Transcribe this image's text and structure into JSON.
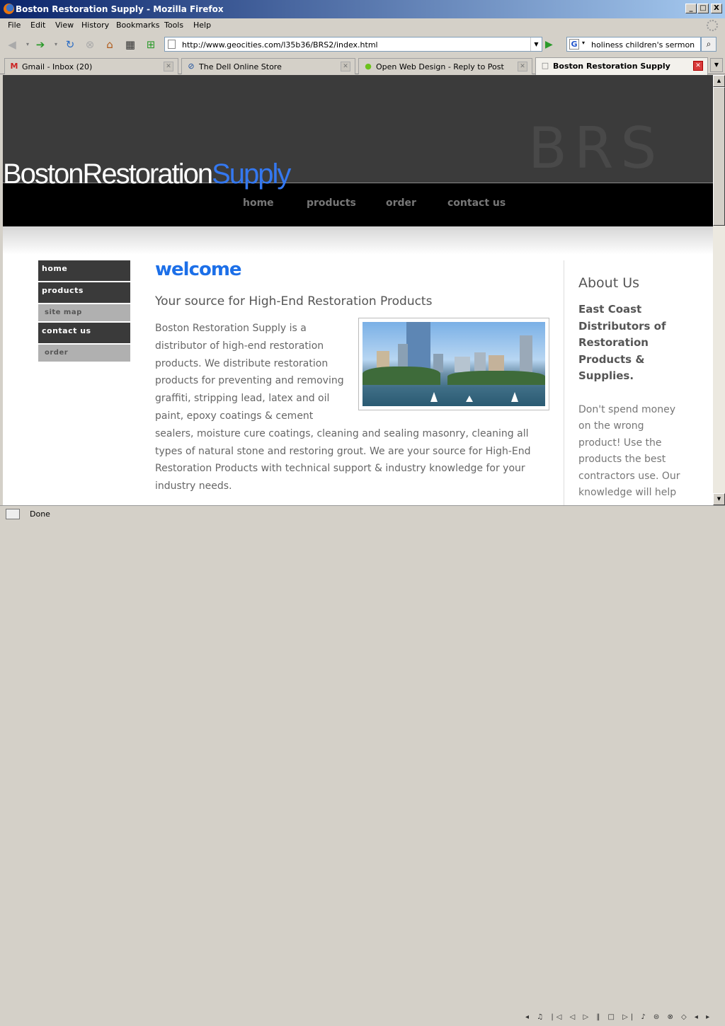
{
  "window": {
    "title": "Boston Restoration Supply - Mozilla Firefox",
    "min": "_",
    "max": "□",
    "close": "X"
  },
  "menu": [
    "File",
    "Edit",
    "View",
    "History",
    "Bookmarks",
    "Tools",
    "Help"
  ],
  "address": {
    "url": "http://www.geocities.com/l35b36/BRS2/index.html"
  },
  "search": {
    "query": "holiness children's sermon",
    "engine": "G"
  },
  "tabs": [
    {
      "label": "Gmail - Inbox (20)",
      "icon": "M"
    },
    {
      "label": "The Dell Online Store",
      "icon": "⊘"
    },
    {
      "label": "Open Web Design - Reply to Post",
      "icon": "●"
    },
    {
      "label": "Boston Restoration Supply",
      "icon": "□"
    }
  ],
  "site": {
    "watermark": "BRS",
    "logo_main": "BostonRestoration",
    "logo_accent": "Supply",
    "topnav": [
      "home",
      "products",
      "order",
      "contact us"
    ],
    "sidenav": [
      "home",
      "products",
      "site map",
      "contact us",
      "order"
    ],
    "welcome": "welcome",
    "tagline": "Your source for High-End Restoration Products",
    "body": "Boston Restoration Supply is a distributor of high-end restoration products. We distribute restoration products for preventing and removing graffiti, stripping lead, latex and oil paint, epoxy coatings & cement sealers, moisture cure coatings, cleaning and sealing masonry, cleaning all types of natural stone and restoring grout. We are your source for High-End Restoration Products with technical support & industry knowledge for your industry needs.",
    "about_heading": "About Us",
    "about_sub": "East Coast Distributors of Restoration Products & Supplies.",
    "about_para": "Don't spend money on the wrong product! Use the products the best contractors use. Our knowledge will help"
  },
  "status": {
    "text": "Done"
  },
  "colors": {
    "accent_blue": "#1c6fe8",
    "logo_blue": "#3478f0",
    "header_dark": "#3b3b3b",
    "nav_black": "#000000"
  }
}
